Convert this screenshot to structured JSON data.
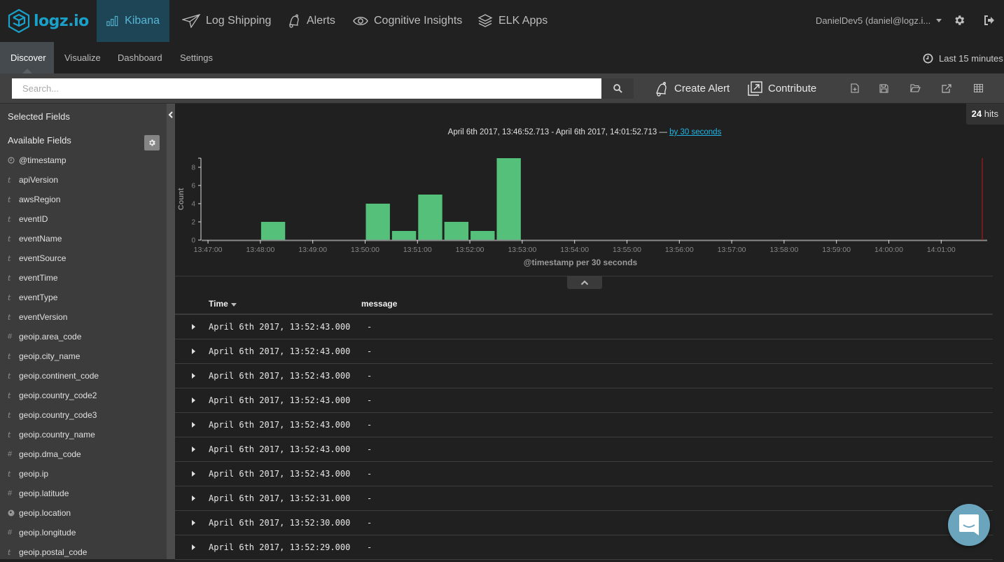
{
  "brand": {
    "name": "logz.io",
    "color": "#1aa1c9"
  },
  "topnav": {
    "items": [
      {
        "label": "Kibana",
        "icon": "bar-chart-icon",
        "active": true
      },
      {
        "label": "Log Shipping",
        "icon": "paper-plane-icon"
      },
      {
        "label": "Alerts",
        "icon": "bell-icon"
      },
      {
        "label": "Cognitive Insights",
        "icon": "eye-icon"
      },
      {
        "label": "ELK Apps",
        "icon": "layers-icon"
      }
    ],
    "user": "DanielDev5 (daniel@logz.i...",
    "settings_icon": "gear-icon",
    "logout_icon": "sign-out-icon"
  },
  "subnav": {
    "tabs": [
      {
        "label": "Discover",
        "active": true
      },
      {
        "label": "Visualize"
      },
      {
        "label": "Dashboard"
      },
      {
        "label": "Settings"
      }
    ],
    "timepicker": "Last 15 minutes"
  },
  "querybar": {
    "search_placeholder": "Search...",
    "search_value": "",
    "create_alert": "Create Alert",
    "contribute": "Contribute",
    "icons": [
      "new-search-icon",
      "save-icon",
      "open-folder-icon",
      "share-icon",
      "table-options-icon"
    ]
  },
  "sidebar": {
    "selected_fields": "Selected Fields",
    "available_fields": "Available Fields",
    "fields": [
      {
        "type": "clock",
        "name": "@timestamp"
      },
      {
        "type": "t",
        "name": "apiVersion"
      },
      {
        "type": "t",
        "name": "awsRegion"
      },
      {
        "type": "t",
        "name": "eventID"
      },
      {
        "type": "t",
        "name": "eventName"
      },
      {
        "type": "t",
        "name": "eventSource"
      },
      {
        "type": "t",
        "name": "eventTime"
      },
      {
        "type": "t",
        "name": "eventType"
      },
      {
        "type": "t",
        "name": "eventVersion"
      },
      {
        "type": "#",
        "name": "geoip.area_code"
      },
      {
        "type": "t",
        "name": "geoip.city_name"
      },
      {
        "type": "t",
        "name": "geoip.continent_code"
      },
      {
        "type": "t",
        "name": "geoip.country_code2"
      },
      {
        "type": "t",
        "name": "geoip.country_code3"
      },
      {
        "type": "t",
        "name": "geoip.country_name"
      },
      {
        "type": "#",
        "name": "geoip.dma_code"
      },
      {
        "type": "t",
        "name": "geoip.ip"
      },
      {
        "type": "#",
        "name": "geoip.latitude"
      },
      {
        "type": "globe",
        "name": "geoip.location"
      },
      {
        "type": "#",
        "name": "geoip.longitude"
      },
      {
        "type": "t",
        "name": "geoip.postal_code"
      }
    ]
  },
  "main": {
    "hits_count": "24",
    "hits_label": "hits",
    "range_text": "April 6th 2017, 13:46:52.713 - April 6th 2017, 14:01:52.713 —",
    "interval_link": "by 30 seconds",
    "table": {
      "columns": [
        "Time",
        "message"
      ],
      "rows": [
        {
          "time": "April 6th 2017, 13:52:43.000",
          "message": "-"
        },
        {
          "time": "April 6th 2017, 13:52:43.000",
          "message": "-"
        },
        {
          "time": "April 6th 2017, 13:52:43.000",
          "message": "-"
        },
        {
          "time": "April 6th 2017, 13:52:43.000",
          "message": "-"
        },
        {
          "time": "April 6th 2017, 13:52:43.000",
          "message": "-"
        },
        {
          "time": "April 6th 2017, 13:52:43.000",
          "message": "-"
        },
        {
          "time": "April 6th 2017, 13:52:43.000",
          "message": "-"
        },
        {
          "time": "April 6th 2017, 13:52:31.000",
          "message": "-"
        },
        {
          "time": "April 6th 2017, 13:52:30.000",
          "message": "-"
        },
        {
          "time": "April 6th 2017, 13:52:29.000",
          "message": "-"
        }
      ]
    }
  },
  "chart_data": {
    "type": "bar",
    "title": "",
    "xlabel": "@timestamp per 30 seconds",
    "ylabel": "Count",
    "x_range": [
      "13:46:52.713",
      "14:01:52.713"
    ],
    "ylim": [
      0,
      9
    ],
    "yticks": [
      0,
      2,
      4,
      6,
      8
    ],
    "xticks": [
      "13:47:00",
      "13:48:00",
      "13:49:00",
      "13:50:00",
      "13:51:00",
      "13:52:00",
      "13:53:00",
      "13:54:00",
      "13:55:00",
      "13:56:00",
      "13:57:00",
      "13:58:00",
      "13:59:00",
      "14:00:00",
      "14:01:00"
    ],
    "categories": [
      "13:48:00",
      "13:50:00",
      "13:50:30",
      "13:51:00",
      "13:51:30",
      "13:52:00",
      "13:52:30"
    ],
    "values": [
      2,
      4,
      1,
      5,
      2,
      1,
      9
    ],
    "bar_color": "#54c07a",
    "now_marker_color": "#8b1a1a",
    "grid": false,
    "legend": "none"
  }
}
